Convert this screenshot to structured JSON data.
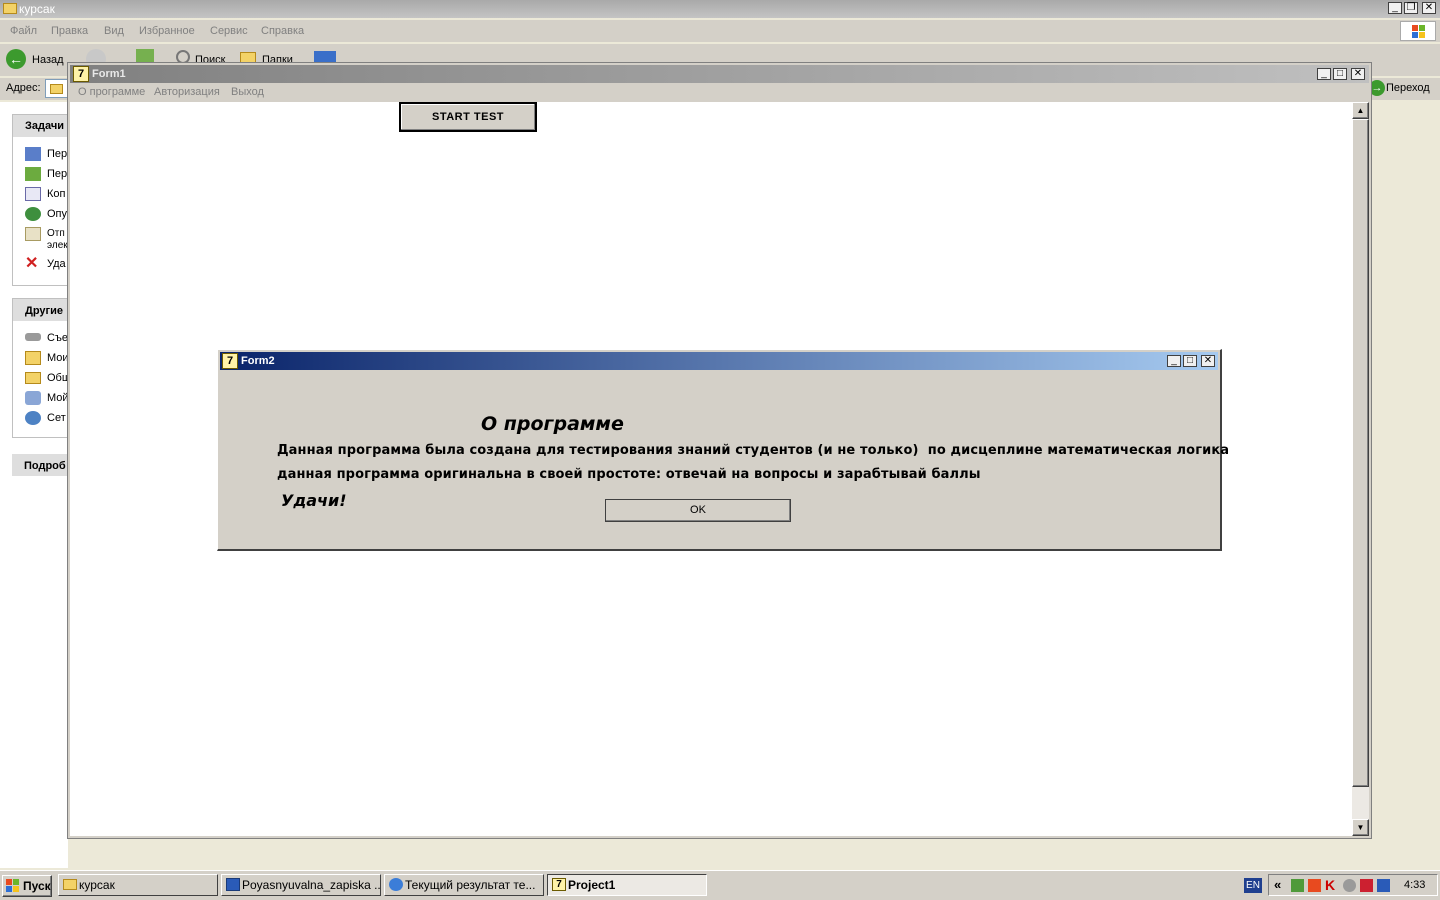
{
  "explorer": {
    "title": "курсак",
    "menu": [
      "Файл",
      "Правка",
      "Вид",
      "Избранное",
      "Сервис",
      "Справка"
    ],
    "toolbar": {
      "back": "Назад",
      "search": "Поиск",
      "folders": "Папки"
    },
    "address_label": "Адрес:",
    "go_label": "Переход",
    "tasks_header": "Задачи",
    "tasks": [
      "Пер",
      "Пер",
      "Коп",
      "Опу",
      "Отп\nэлек",
      "Уда"
    ],
    "other_header": "Другие",
    "other": [
      "Съе",
      "Мои",
      "Общ",
      "Мой",
      "Сет"
    ],
    "details_header": "Подроб"
  },
  "form1": {
    "title": "Form1",
    "menu": [
      "О программе",
      "Авторизация",
      "Выход"
    ],
    "start_button": "START TEST"
  },
  "form2": {
    "title": "Form2",
    "heading": "О программе",
    "line1": "Данная программа была создана для тестирования знаний студентов (и не только)  по дисцеплине математическая логика",
    "line2": "данная программа оригинальна в своей простоте: отвечай на вопросы и зарабтывай баллы",
    "wish": "Удачи!",
    "ok": "OK"
  },
  "taskbar": {
    "start": "Пуск",
    "items": [
      "курсак",
      "Poyasnyuvalna_zapiska ...",
      "Текущий результат те...",
      "Project1"
    ],
    "lang": "EN",
    "clock": "4:33"
  },
  "colors": {
    "dialog_bg": "#d4d0c8",
    "title_active_start": "#0a246a",
    "title_active_end": "#a6caf0",
    "title_inactive": "#808080"
  }
}
